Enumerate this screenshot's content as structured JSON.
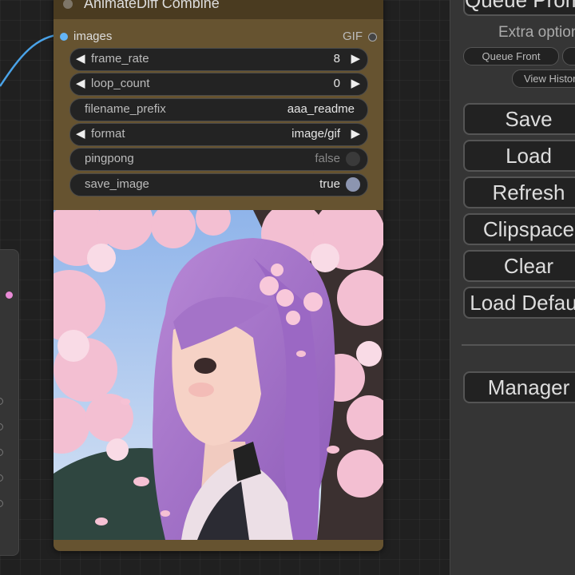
{
  "node": {
    "title": "AnimateDiff Combine",
    "input_label": "images",
    "output_label": "GIF",
    "widgets": {
      "frame_rate": {
        "label": "frame_rate",
        "value": "8"
      },
      "loop_count": {
        "label": "loop_count",
        "value": "0"
      },
      "filename_prefix": {
        "label": "filename_prefix",
        "value": "aaa_readme"
      },
      "format": {
        "label": "format",
        "value": "image/gif"
      },
      "pingpong": {
        "label": "pingpong",
        "value": "false"
      },
      "save_image": {
        "label": "save_image",
        "value": "true"
      }
    },
    "arrows": {
      "left": "◀",
      "right": "▶"
    }
  },
  "panel": {
    "queue_prompt_label": "Queue Prompt",
    "extra_options_label": "Extra options",
    "queue_front_label": "Queue Front",
    "view_history_label": "View History",
    "save_label": "Save",
    "load_label": "Load",
    "refresh_label": "Refresh",
    "clipspace_label": "Clipspace",
    "clear_label": "Clear",
    "load_default_label": "Load Default",
    "manager_label": "Manager"
  },
  "colors": {
    "node_body": "#665330",
    "node_title": "#4a3b20",
    "image_slot": "#64b5f6",
    "wire": "#4aa3e8"
  }
}
